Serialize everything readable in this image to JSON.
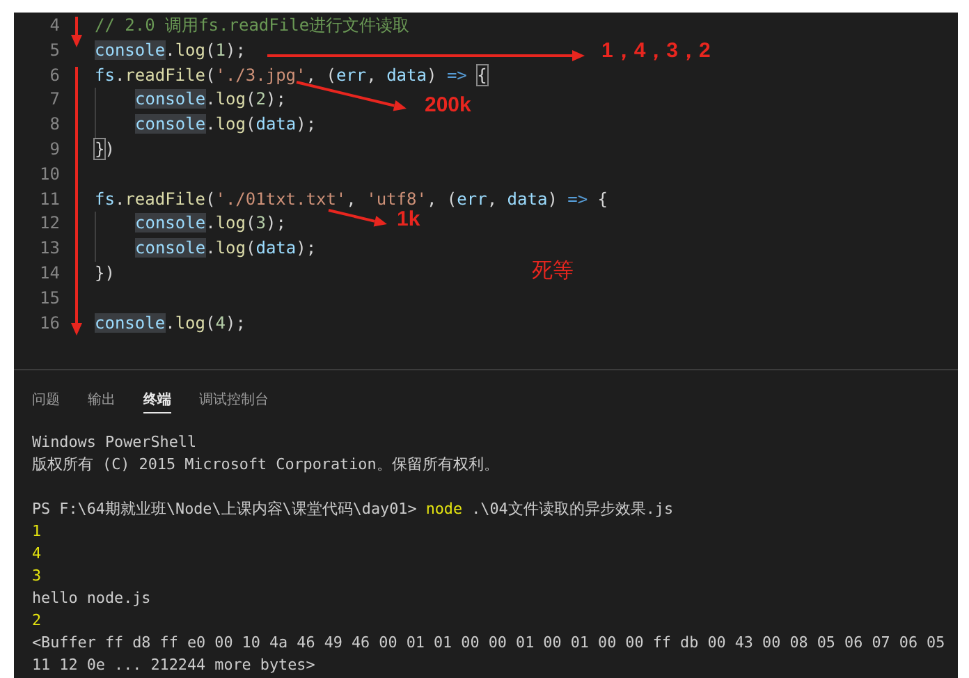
{
  "editor": {
    "lines": [
      {
        "number": "4",
        "tokens": [
          {
            "text": "// 2.0 调用fs.readFile进行文件读取",
            "kind": "comment"
          }
        ]
      },
      {
        "number": "5",
        "tokens": [
          {
            "text": "console",
            "kind": "var-hl"
          },
          {
            "text": ".",
            "kind": "punct"
          },
          {
            "text": "log",
            "kind": "func"
          },
          {
            "text": "(",
            "kind": "punct"
          },
          {
            "text": "1",
            "kind": "number"
          },
          {
            "text": ");",
            "kind": "punct"
          }
        ]
      },
      {
        "number": "6",
        "tokens": [
          {
            "text": "fs",
            "kind": "var"
          },
          {
            "text": ".",
            "kind": "punct"
          },
          {
            "text": "readFile",
            "kind": "func"
          },
          {
            "text": "(",
            "kind": "punct"
          },
          {
            "text": "'./3.jpg'",
            "kind": "string"
          },
          {
            "text": ", (",
            "kind": "punct"
          },
          {
            "text": "err",
            "kind": "var"
          },
          {
            "text": ", ",
            "kind": "punct"
          },
          {
            "text": "data",
            "kind": "var"
          },
          {
            "text": ") ",
            "kind": "punct"
          },
          {
            "text": "=>",
            "kind": "keyword"
          },
          {
            "text": "{",
            "kind": "brace-match"
          }
        ],
        "children": [
          {
            "number": "7",
            "tokens": [
              {
                "text": "console",
                "kind": "var-hl"
              },
              {
                "text": ".",
                "kind": "punct"
              },
              {
                "text": "log",
                "kind": "func"
              },
              {
                "text": "(",
                "kind": "punct"
              },
              {
                "text": "2",
                "kind": "number"
              },
              {
                "text": ");",
                "kind": "punct"
              }
            ]
          },
          {
            "number": "8",
            "tokens": [
              {
                "text": "console",
                "kind": "var-hl"
              },
              {
                "text": ".",
                "kind": "punct"
              },
              {
                "text": "log",
                "kind": "func"
              },
              {
                "text": "(",
                "kind": "punct"
              },
              {
                "text": "data",
                "kind": "var"
              },
              {
                "text": ");",
                "kind": "punct"
              }
            ]
          }
        ]
      },
      {
        "number": "9",
        "tokens": [
          {
            "text": "}",
            "kind": "brace-match"
          },
          {
            "text": ")",
            "kind": "punct"
          }
        ]
      },
      {
        "number": "10"
      },
      {
        "number": "11",
        "tokens": [
          {
            "text": "fs",
            "kind": "var"
          },
          {
            "text": ".",
            "kind": "punct"
          },
          {
            "text": "readFile",
            "kind": "func"
          },
          {
            "text": "(",
            "kind": "punct"
          },
          {
            "text": "'./01txt.txt'",
            "kind": "string"
          },
          {
            "text": ", ",
            "kind": "punct"
          },
          {
            "text": "'utf8'",
            "kind": "string"
          },
          {
            "text": ", (",
            "kind": "punct"
          },
          {
            "text": "err",
            "kind": "var"
          },
          {
            "text": ", ",
            "kind": "punct"
          },
          {
            "text": "data",
            "kind": "var"
          },
          {
            "text": ") ",
            "kind": "punct"
          },
          {
            "text": "=>",
            "kind": "keyword"
          },
          {
            "text": "{",
            "kind": "punct"
          }
        ],
        "children": [
          {
            "number": "12",
            "tokens": [
              {
                "text": "console",
                "kind": "var-hl"
              },
              {
                "text": ".",
                "kind": "punct"
              },
              {
                "text": "log",
                "kind": "func"
              },
              {
                "text": "(",
                "kind": "punct"
              },
              {
                "text": "3",
                "kind": "number"
              },
              {
                "text": ");",
                "kind": "punct"
              }
            ]
          },
          {
            "number": "13",
            "tokens": [
              {
                "text": "console",
                "kind": "var-hl"
              },
              {
                "text": ".",
                "kind": "punct"
              },
              {
                "text": "log",
                "kind": "func"
              },
              {
                "text": "(",
                "kind": "punct"
              },
              {
                "text": "data",
                "kind": "var"
              },
              {
                "text": ");",
                "kind": "punct"
              }
            ]
          }
        ]
      },
      {
        "number": "14",
        "tokens": [
          {
            "text": "})",
            "kind": "punct"
          }
        ]
      },
      {
        "number": "15"
      },
      {
        "number": "16",
        "tokens": [
          {
            "text": "console",
            "kind": "var-hl"
          },
          {
            "text": ".",
            "kind": "punct"
          },
          {
            "text": "log",
            "kind": "func"
          },
          {
            "text": "(",
            "kind": "punct"
          },
          {
            "text": "4",
            "kind": "number"
          },
          {
            "text": ");",
            "kind": "punct"
          }
        ]
      }
    ],
    "annotations": [
      {
        "text": "1，4，3，2",
        "kind": "label"
      },
      {
        "text": "200k",
        "kind": "label"
      },
      {
        "text": "1k",
        "kind": "label"
      },
      {
        "text": "死等",
        "kind": "note"
      }
    ]
  },
  "panel": {
    "tabs": [
      {
        "label": "问题",
        "selected": false
      },
      {
        "label": "输出",
        "selected": false
      },
      {
        "label": "终端",
        "selected": true
      },
      {
        "label": "调试控制台",
        "selected": false
      }
    ],
    "terminal": [
      {
        "kind": "text",
        "text": "Windows PowerShell"
      },
      {
        "kind": "text",
        "text": "版权所有 (C) 2015 Microsoft Corporation。保留所有权利。"
      },
      {
        "kind": "blank"
      },
      {
        "kind": "prompt",
        "path": "PS F:\\64期就业班\\Node\\上课内容\\课堂代码\\day01>",
        "command": "node",
        "args": ".\\04文件读取的异步效果.js"
      },
      {
        "kind": "number",
        "text": "1"
      },
      {
        "kind": "number",
        "text": "4"
      },
      {
        "kind": "number",
        "text": "3"
      },
      {
        "kind": "text",
        "text": "hello node.js"
      },
      {
        "kind": "number",
        "text": "2"
      },
      {
        "kind": "text",
        "text": "<Buffer ff d8 ff e0 00 10 4a 46 49 46 00 01 01 00 00 01 00 01 00 00 ff db 00 43 00 08 05 06 07 06 05"
      },
      {
        "kind": "text",
        "text": "11 12 0e ... 212244 more bytes>"
      }
    ]
  }
}
